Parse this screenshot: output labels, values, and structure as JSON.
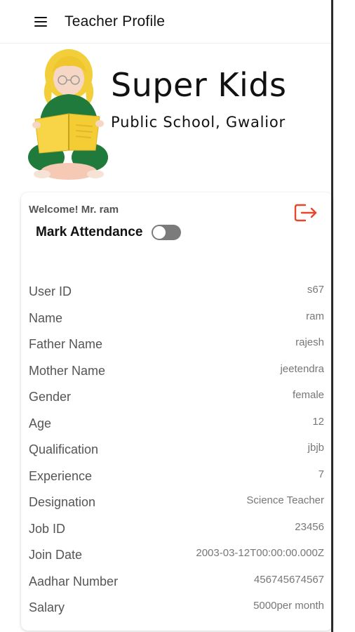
{
  "appbar": {
    "title": "Teacher Profile",
    "menu_icon": "hamburger-menu-icon"
  },
  "banner": {
    "title": "Super Kids",
    "subtitle": "Public School, Gwalior",
    "illustration": "girl-reading-book"
  },
  "card": {
    "welcome": "Welcome! Mr. ram",
    "attendance_label": "Mark Attendance",
    "attendance_on": false,
    "logout_icon": "logout-icon",
    "logout_color": "#e8472e"
  },
  "profile": [
    {
      "label": "User ID",
      "value": "s67"
    },
    {
      "label": "Name",
      "value": "ram"
    },
    {
      "label": "Father Name",
      "value": "rajesh"
    },
    {
      "label": "Mother Name",
      "value": "jeetendra"
    },
    {
      "label": "Gender",
      "value": "female"
    },
    {
      "label": "Age",
      "value": "12"
    },
    {
      "label": "Qualification",
      "value": "jbjb"
    },
    {
      "label": "Experience",
      "value": "7"
    },
    {
      "label": "Designation",
      "value": "Science Teacher"
    },
    {
      "label": "Job ID",
      "value": "23456"
    },
    {
      "label": "Join Date",
      "value": "2003-03-12T00:00:00.000Z"
    },
    {
      "label": "Aadhar Number",
      "value": "456745674567"
    },
    {
      "label": "Salary",
      "value": "5000per month"
    }
  ]
}
